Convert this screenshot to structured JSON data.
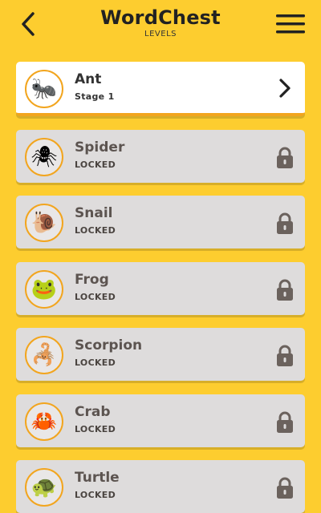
{
  "header": {
    "title": "WordChest",
    "subtitle": "LEVELS",
    "back_icon": "chevron-left-icon",
    "menu_icon": "hamburger-menu-icon"
  },
  "colors": {
    "background": "#FDCD2F",
    "accent": "#F2A51E",
    "card_unlocked": "#FFFFFF",
    "card_locked": "#DEDCDC",
    "lock": "#6B625D"
  },
  "levels": [
    {
      "name": "Ant",
      "status": "Stage 1",
      "locked": false,
      "icon": "ant-icon",
      "glyph": "🐜"
    },
    {
      "name": "Spider",
      "status": "LOCKED",
      "locked": true,
      "icon": "spider-icon",
      "glyph": "🕷"
    },
    {
      "name": "Snail",
      "status": "LOCKED",
      "locked": true,
      "icon": "snail-icon",
      "glyph": "🐌"
    },
    {
      "name": "Frog",
      "status": "LOCKED",
      "locked": true,
      "icon": "frog-icon",
      "glyph": "🐸"
    },
    {
      "name": "Scorpion",
      "status": "LOCKED",
      "locked": true,
      "icon": "scorpion-icon",
      "glyph": "🦂"
    },
    {
      "name": "Crab",
      "status": "LOCKED",
      "locked": true,
      "icon": "crab-icon",
      "glyph": "🦀"
    },
    {
      "name": "Turtle",
      "status": "LOCKED",
      "locked": true,
      "icon": "turtle-icon",
      "glyph": "🐢"
    }
  ]
}
